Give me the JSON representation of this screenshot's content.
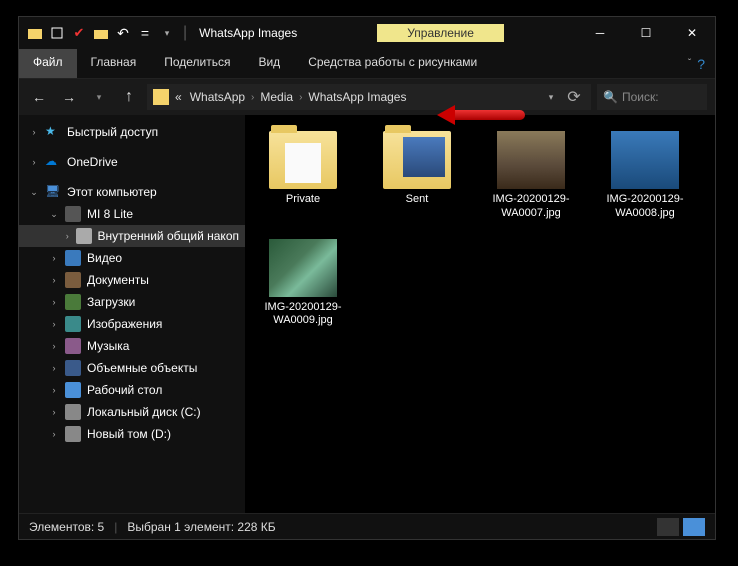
{
  "title": "WhatsApp Images",
  "context_tab": "Управление",
  "ribbon": {
    "file": "Файл",
    "home": "Главная",
    "share": "Поделиться",
    "view": "Вид",
    "pictools": "Средства работы с рисунками"
  },
  "breadcrumbs": [
    "WhatsApp",
    "Media",
    "WhatsApp Images"
  ],
  "crumb_prefix": "«",
  "search_placeholder": "Поиск: ",
  "sidebar": {
    "quick": "Быстрый доступ",
    "onedrive": "OneDrive",
    "thispc": "Этот компьютер",
    "phone": "MI 8 Lite",
    "internal": "Внутренний общий накоп",
    "video": "Видео",
    "docs": "Документы",
    "downloads": "Загрузки",
    "pictures": "Изображения",
    "music": "Музыка",
    "objects3d": "Объемные объекты",
    "desktop": "Рабочий стол",
    "cdrive": "Локальный диск (C:)",
    "ddrive": "Новый том (D:)"
  },
  "files": [
    {
      "name": "Private",
      "kind": "folder-priv"
    },
    {
      "name": "Sent",
      "kind": "folder-sent"
    },
    {
      "name": "IMG-20200129-WA0007.jpg",
      "kind": "img1"
    },
    {
      "name": "IMG-20200129-WA0008.jpg",
      "kind": "img2"
    },
    {
      "name": "IMG-20200129-WA0009.jpg",
      "kind": "img3"
    }
  ],
  "status": {
    "count_label": "Элементов: 5",
    "selection": "Выбран 1 элемент: 228 КБ"
  }
}
